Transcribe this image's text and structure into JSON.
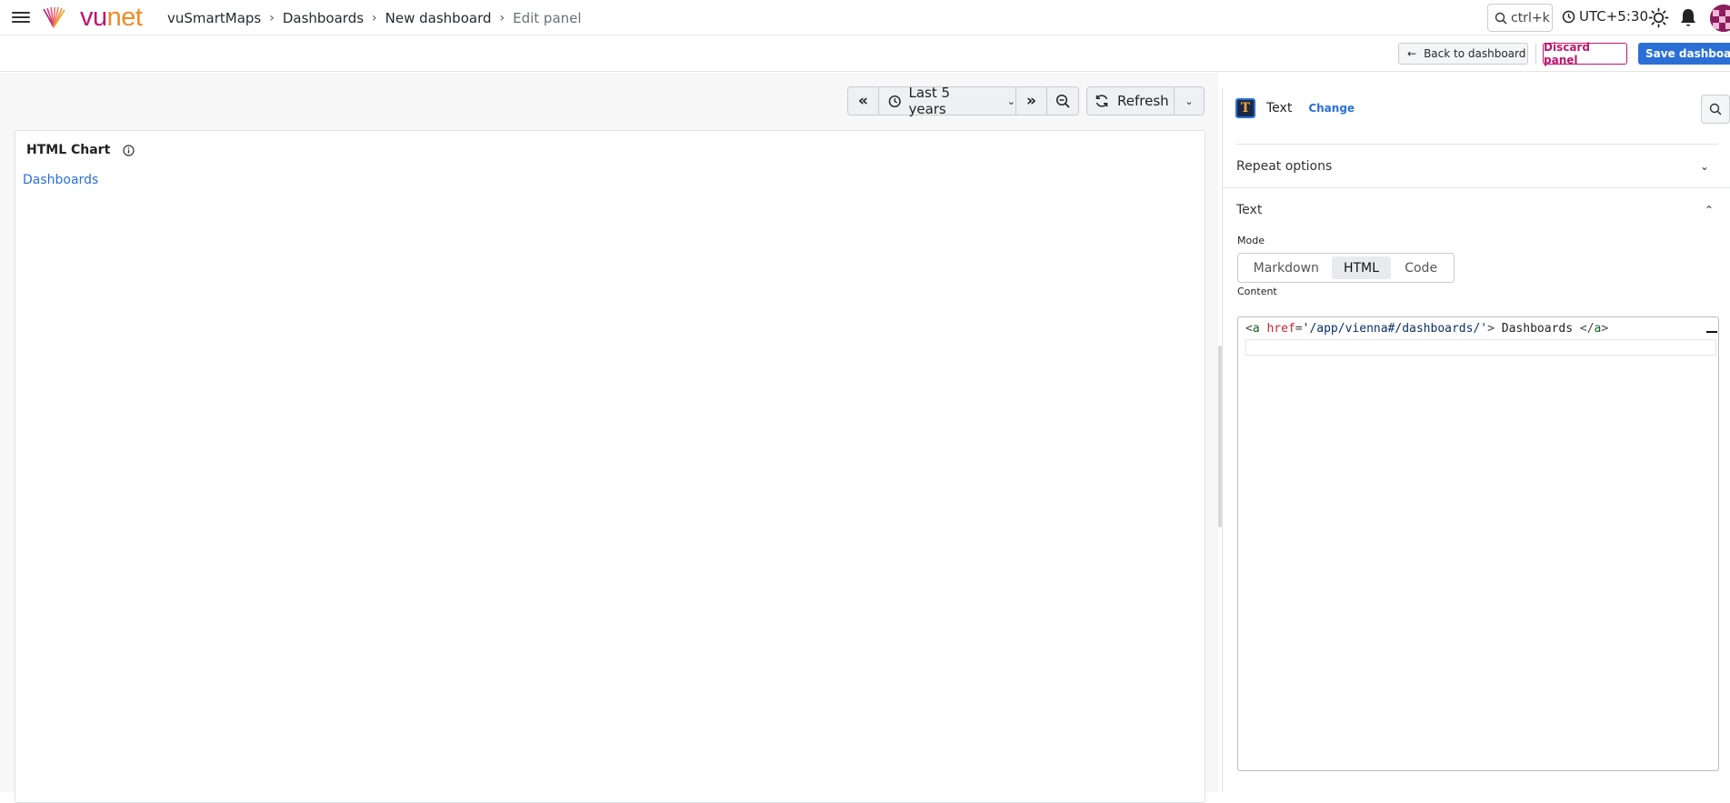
{
  "app": {
    "logo_vu": "vu",
    "logo_net": "net"
  },
  "breadcrumb": [
    "vuSmartMaps",
    "Dashboards",
    "New dashboard",
    "Edit panel"
  ],
  "topbar": {
    "search_shortcut": "ctrl+k",
    "timezone": "UTC+5:30"
  },
  "subbar": {
    "back_label": "Back to dashboard",
    "discard_label": "Discard panel",
    "save_label": "Save dashboard"
  },
  "timepicker": {
    "range_label": "Last 5 years",
    "refresh_label": "Refresh"
  },
  "panel": {
    "title": "HTML Chart",
    "link_text": "Dashboards"
  },
  "options": {
    "visualization": "Text",
    "change_label": "Change",
    "sections": {
      "repeat": "Repeat options",
      "text": "Text"
    },
    "mode_label": "Mode",
    "modes": [
      "Markdown",
      "HTML",
      "Code"
    ],
    "selected_mode": "HTML",
    "content_label": "Content",
    "content": {
      "lt": "<",
      "tag_open": "a",
      "attr": "href",
      "eq": "=",
      "value": "'/app/vienna#/dashboards/'",
      "gt": ">",
      "text": " Dashboards ",
      "lt_slash": "</",
      "tag_close": "a",
      "gt_end": ">"
    }
  },
  "colors": {
    "brand_magenta": "#c0166b",
    "brand_orange": "#f08a24",
    "primary_blue": "#2b6fd6"
  }
}
